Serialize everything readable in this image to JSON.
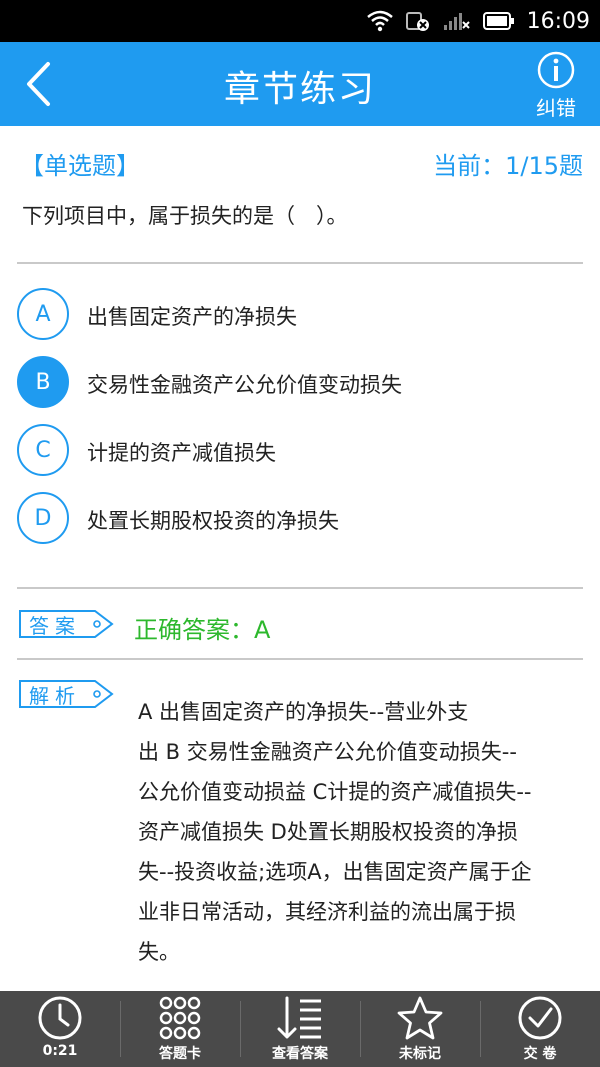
{
  "statusbar": {
    "time": "16:09"
  },
  "navbar": {
    "title": "章节练习",
    "report_label": "纠错"
  },
  "question": {
    "type": "【单选题】",
    "progress": "当前：1/15题",
    "text": "下列项目中，属于损失的是（　）。"
  },
  "options": [
    {
      "letter": "A",
      "text": "出售固定资产的净损失",
      "selected": false
    },
    {
      "letter": "B",
      "text": "交易性金融资产公允价值变动损失",
      "selected": true
    },
    {
      "letter": "C",
      "text": "计提的资产减值损失",
      "selected": false
    },
    {
      "letter": "D",
      "text": "处置长期股权投资的净损失",
      "selected": false
    }
  ],
  "answer": {
    "tag": "答案",
    "text": "正确答案：A"
  },
  "analysis": {
    "tag": "解析",
    "lines": [
      "A 出售固定资产的净损失--营业外支",
      "出 B 交易性金融资产公允价值变动损失--",
      "公允价值变动损益 C计提的资产减值损失--",
      "资产减值损失 D处置长期股权投资的净损",
      "失--投资收益;选项A，出售固定资产属于企",
      "业非日常活动，其经济利益的流出属于损",
      "失。"
    ]
  },
  "bottombar": {
    "timer": "0:21",
    "answer_card": "答题卡",
    "view_answer": "查看答案",
    "unmarked": "未标记",
    "submit": "交 卷"
  },
  "colors": {
    "accent": "#1f9bf0",
    "correct": "#2db82d",
    "bottombar": "#4a4a4a"
  }
}
